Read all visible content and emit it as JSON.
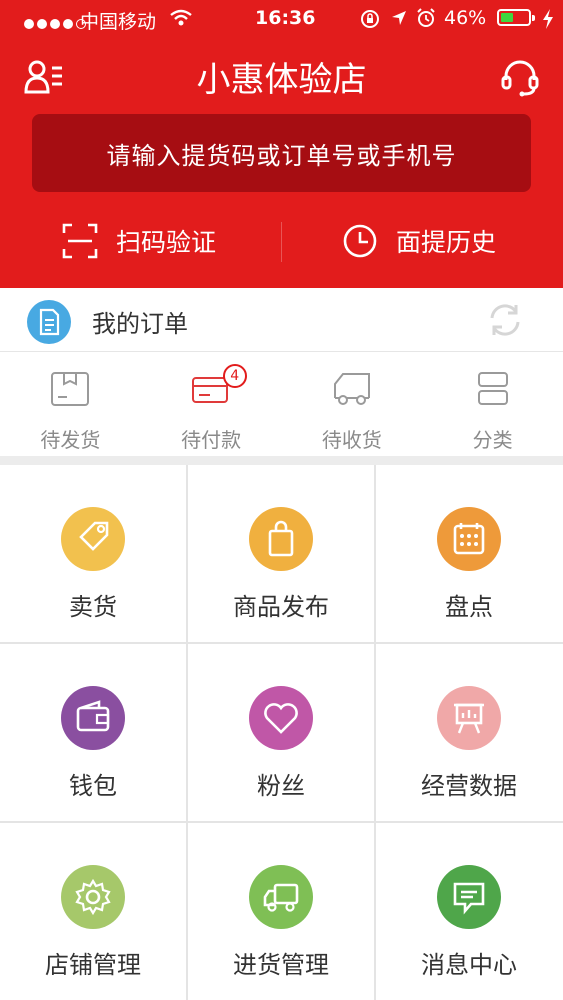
{
  "status_bar": {
    "carrier": "中国移动",
    "time": "16:36",
    "battery": "46%",
    "battery_level": 0.46
  },
  "header": {
    "title": "小惠体验店",
    "left_icon": "user-list-icon",
    "right_icon": "headset-icon"
  },
  "search": {
    "placeholder": "请输入提货码或订单号或手机号"
  },
  "actions": [
    {
      "label": "扫码验证",
      "icon": "scan-icon"
    },
    {
      "label": "面提历史",
      "icon": "clock-icon"
    }
  ],
  "orders": {
    "label": "我的订单",
    "icon": "document-icon",
    "refresh_icon": "refresh-icon"
  },
  "order_status": [
    {
      "label": "待发货",
      "icon": "box-icon"
    },
    {
      "label": "待付款",
      "icon": "card-icon",
      "badge": "4"
    },
    {
      "label": "待收货",
      "icon": "truck-icon"
    },
    {
      "label": "分类",
      "icon": "category-icon"
    }
  ],
  "grid": [
    {
      "label": "卖货",
      "icon": "tag-icon",
      "color": "#f2c14e"
    },
    {
      "label": "商品发布",
      "icon": "bag-icon",
      "color": "#f0b03f"
    },
    {
      "label": "盘点",
      "icon": "calendar-icon",
      "color": "#ee9a3a"
    },
    {
      "label": "钱包",
      "icon": "wallet-icon",
      "color": "#8a4fa0"
    },
    {
      "label": "粉丝",
      "icon": "heart-icon",
      "color": "#c057a7"
    },
    {
      "label": "经营数据",
      "icon": "presentation-icon",
      "color": "#f0a8a8"
    },
    {
      "label": "店铺管理",
      "icon": "gear-icon",
      "color": "#a6c86a"
    },
    {
      "label": "进货管理",
      "icon": "delivery-truck-icon",
      "color": "#7fbf55"
    },
    {
      "label": "消息中心",
      "icon": "message-icon",
      "color": "#4fa64a"
    }
  ]
}
